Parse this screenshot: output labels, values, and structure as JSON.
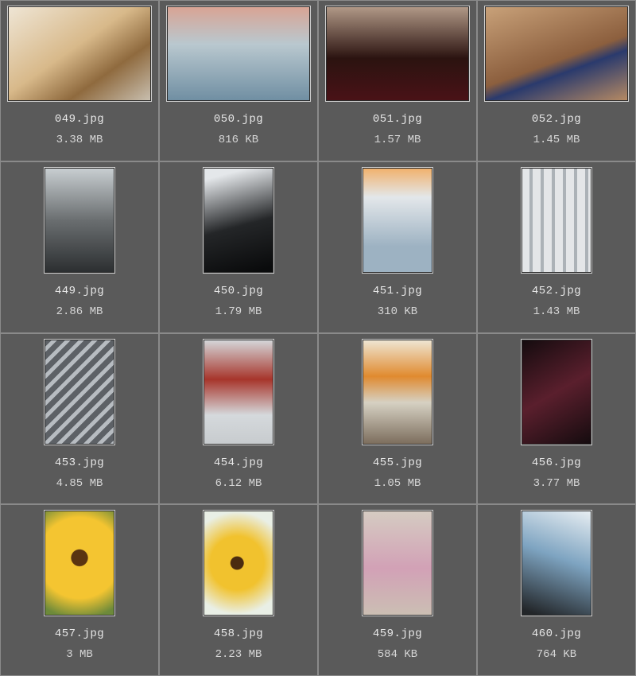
{
  "cells": [
    {
      "filename": "049.jpg",
      "size": "3.38 MB",
      "orient": "landscape",
      "thumbClass": "t0"
    },
    {
      "filename": "050.jpg",
      "size": "816 KB",
      "orient": "landscape",
      "thumbClass": "t1"
    },
    {
      "filename": "051.jpg",
      "size": "1.57 MB",
      "orient": "landscape",
      "thumbClass": "t2"
    },
    {
      "filename": "052.jpg",
      "size": "1.45 MB",
      "orient": "landscape",
      "thumbClass": "t3"
    },
    {
      "filename": "449.jpg",
      "size": "2.86 MB",
      "orient": "portrait",
      "thumbClass": "t4"
    },
    {
      "filename": "450.jpg",
      "size": "1.79 MB",
      "orient": "portrait",
      "thumbClass": "t5"
    },
    {
      "filename": "451.jpg",
      "size": "310 KB",
      "orient": "portrait",
      "thumbClass": "t6"
    },
    {
      "filename": "452.jpg",
      "size": "1.43 MB",
      "orient": "portrait",
      "thumbClass": "t7"
    },
    {
      "filename": "453.jpg",
      "size": "4.85 MB",
      "orient": "portrait",
      "thumbClass": "t8"
    },
    {
      "filename": "454.jpg",
      "size": "6.12 MB",
      "orient": "portrait",
      "thumbClass": "t9"
    },
    {
      "filename": "455.jpg",
      "size": "1.05 MB",
      "orient": "portrait",
      "thumbClass": "t10"
    },
    {
      "filename": "456.jpg",
      "size": "3.77 MB",
      "orient": "portrait",
      "thumbClass": "t11"
    },
    {
      "filename": "457.jpg",
      "size": "3 MB",
      "orient": "portrait",
      "thumbClass": "t12"
    },
    {
      "filename": "458.jpg",
      "size": "2.23 MB",
      "orient": "portrait",
      "thumbClass": "t13"
    },
    {
      "filename": "459.jpg",
      "size": "584 KB",
      "orient": "portrait",
      "thumbClass": "t14"
    },
    {
      "filename": "460.jpg",
      "size": "764 KB",
      "orient": "portrait",
      "thumbClass": "t15"
    }
  ]
}
